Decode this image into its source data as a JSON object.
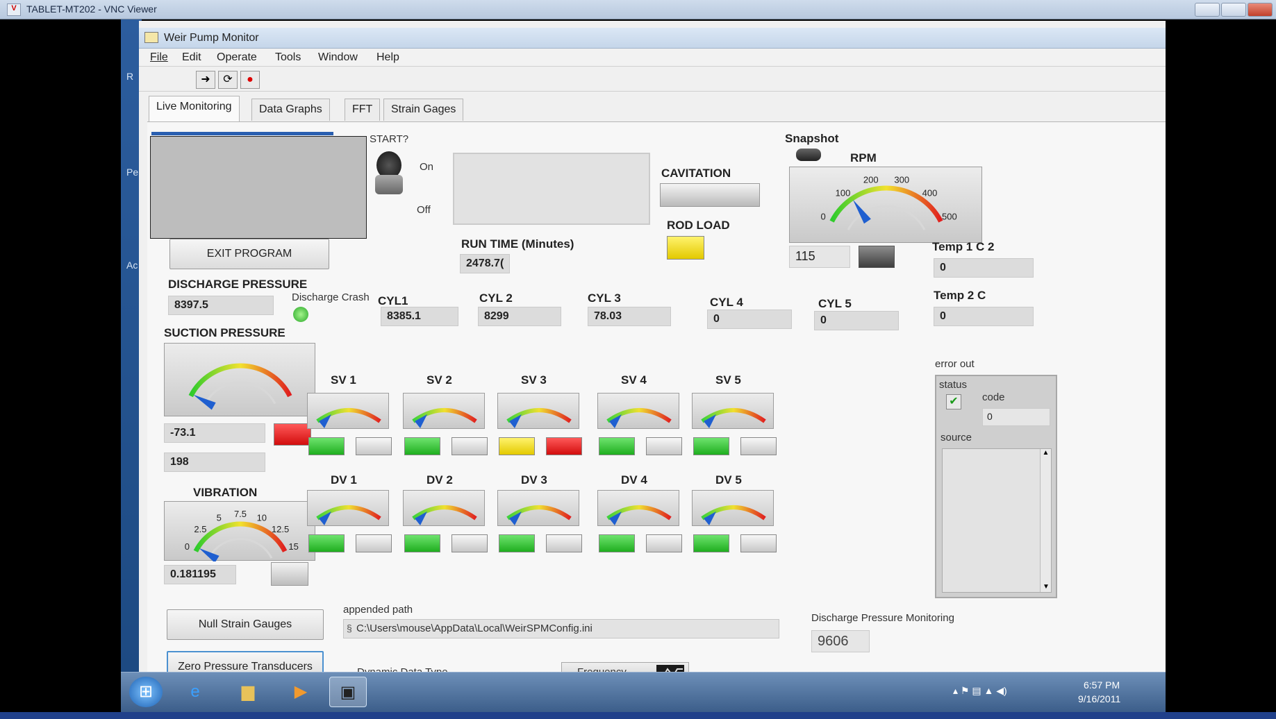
{
  "vnc": {
    "title": "TABLET-MT202 - VNC Viewer"
  },
  "desktop": {
    "side_letters": [
      "R",
      "Pe",
      "Ac"
    ]
  },
  "app": {
    "title": "Weir Pump Monitor",
    "menu": [
      "File",
      "Edit",
      "Operate",
      "Tools",
      "Window",
      "Help"
    ],
    "toolbar": {
      "run_icon": "arrow-run-icon",
      "continuous_icon": "continuous-run-icon",
      "stop_icon": "stop-icon"
    }
  },
  "tabs": [
    "Live Monitoring",
    "Data Graphs",
    "FFT",
    "Strain Gages"
  ],
  "live": {
    "start_label": "START?",
    "switch_on": "On",
    "switch_off": "Off",
    "exit_button": "EXIT PROGRAM",
    "run_time_label": "RUN TIME (Minutes)",
    "run_time_value": "2478.7(",
    "cavitation_label": "CAVITATION",
    "rod_load_label": "ROD LOAD",
    "snapshot_label": "Snapshot",
    "rpm_label": "RPM",
    "rpm_ticks": [
      "0",
      "100",
      "200",
      "300",
      "400",
      "500"
    ],
    "rpm_value": "115",
    "temp1_label": "Temp 1 C 2",
    "temp1_value": "0",
    "temp2_label": "Temp 2 C",
    "temp2_value": "0",
    "discharge_label": "DISCHARGE PRESSURE",
    "discharge_value": "8397.5",
    "discharge_crash_label": "Discharge Crash",
    "cylinders": [
      {
        "label": "CYL1",
        "value": "8385.1"
      },
      {
        "label": "CYL 2",
        "value": "8299"
      },
      {
        "label": "CYL 3",
        "value": "78.03"
      },
      {
        "label": "CYL 4",
        "value": "0"
      },
      {
        "label": "CYL 5",
        "value": "0"
      }
    ],
    "suction_label": "SUCTION PRESSURE",
    "suction_value": "-73.1",
    "suction_value2": "198",
    "vibration_label": "VIBRATION",
    "vibration_ticks": [
      "0",
      "2.5",
      "5",
      "7.5",
      "10",
      "12.5",
      "15"
    ],
    "vibration_value": "0.181195",
    "sv": [
      {
        "label": "SV 1",
        "leds": [
          "green",
          "off"
        ]
      },
      {
        "label": "SV 2",
        "leds": [
          "green",
          "off"
        ]
      },
      {
        "label": "SV 3",
        "leds": [
          "yellow",
          "red"
        ]
      },
      {
        "label": "SV 4",
        "leds": [
          "green",
          "off"
        ]
      },
      {
        "label": "SV 5",
        "leds": [
          "green",
          "off"
        ]
      }
    ],
    "dv": [
      {
        "label": "DV 1",
        "leds": [
          "green",
          "off"
        ]
      },
      {
        "label": "DV 2",
        "leds": [
          "green",
          "off"
        ]
      },
      {
        "label": "DV 3",
        "leds": [
          "green",
          "off"
        ]
      },
      {
        "label": "DV 4",
        "leds": [
          "green",
          "off"
        ]
      },
      {
        "label": "DV 5",
        "leds": [
          "green",
          "off"
        ]
      }
    ],
    "error_out_label": "error out",
    "status_label": "status",
    "code_label": "code",
    "code_value": "0",
    "source_label": "source",
    "null_strain_button": "Null Strain Gauges",
    "zero_pressure_button": "Zero Pressure Transducers",
    "appended_path_label": "appended path",
    "appended_path_value": "C:\\Users\\mouse\\AppData\\Local\\WeirSPMConfig.ini",
    "discharge_monitoring_label": "Discharge Pressure Monitoring",
    "discharge_monitoring_value": "9606",
    "dynamic_data_type_label": "Dynamic Data Type",
    "frequency_label": "Frequency"
  },
  "taskbar": {
    "time": "6:57 PM",
    "date": "9/16/2011"
  },
  "colors": {
    "accent": "#2a5fb0",
    "led_green": "#1fae1f",
    "led_red": "#d20d0d",
    "led_yellow": "#e3c900"
  }
}
